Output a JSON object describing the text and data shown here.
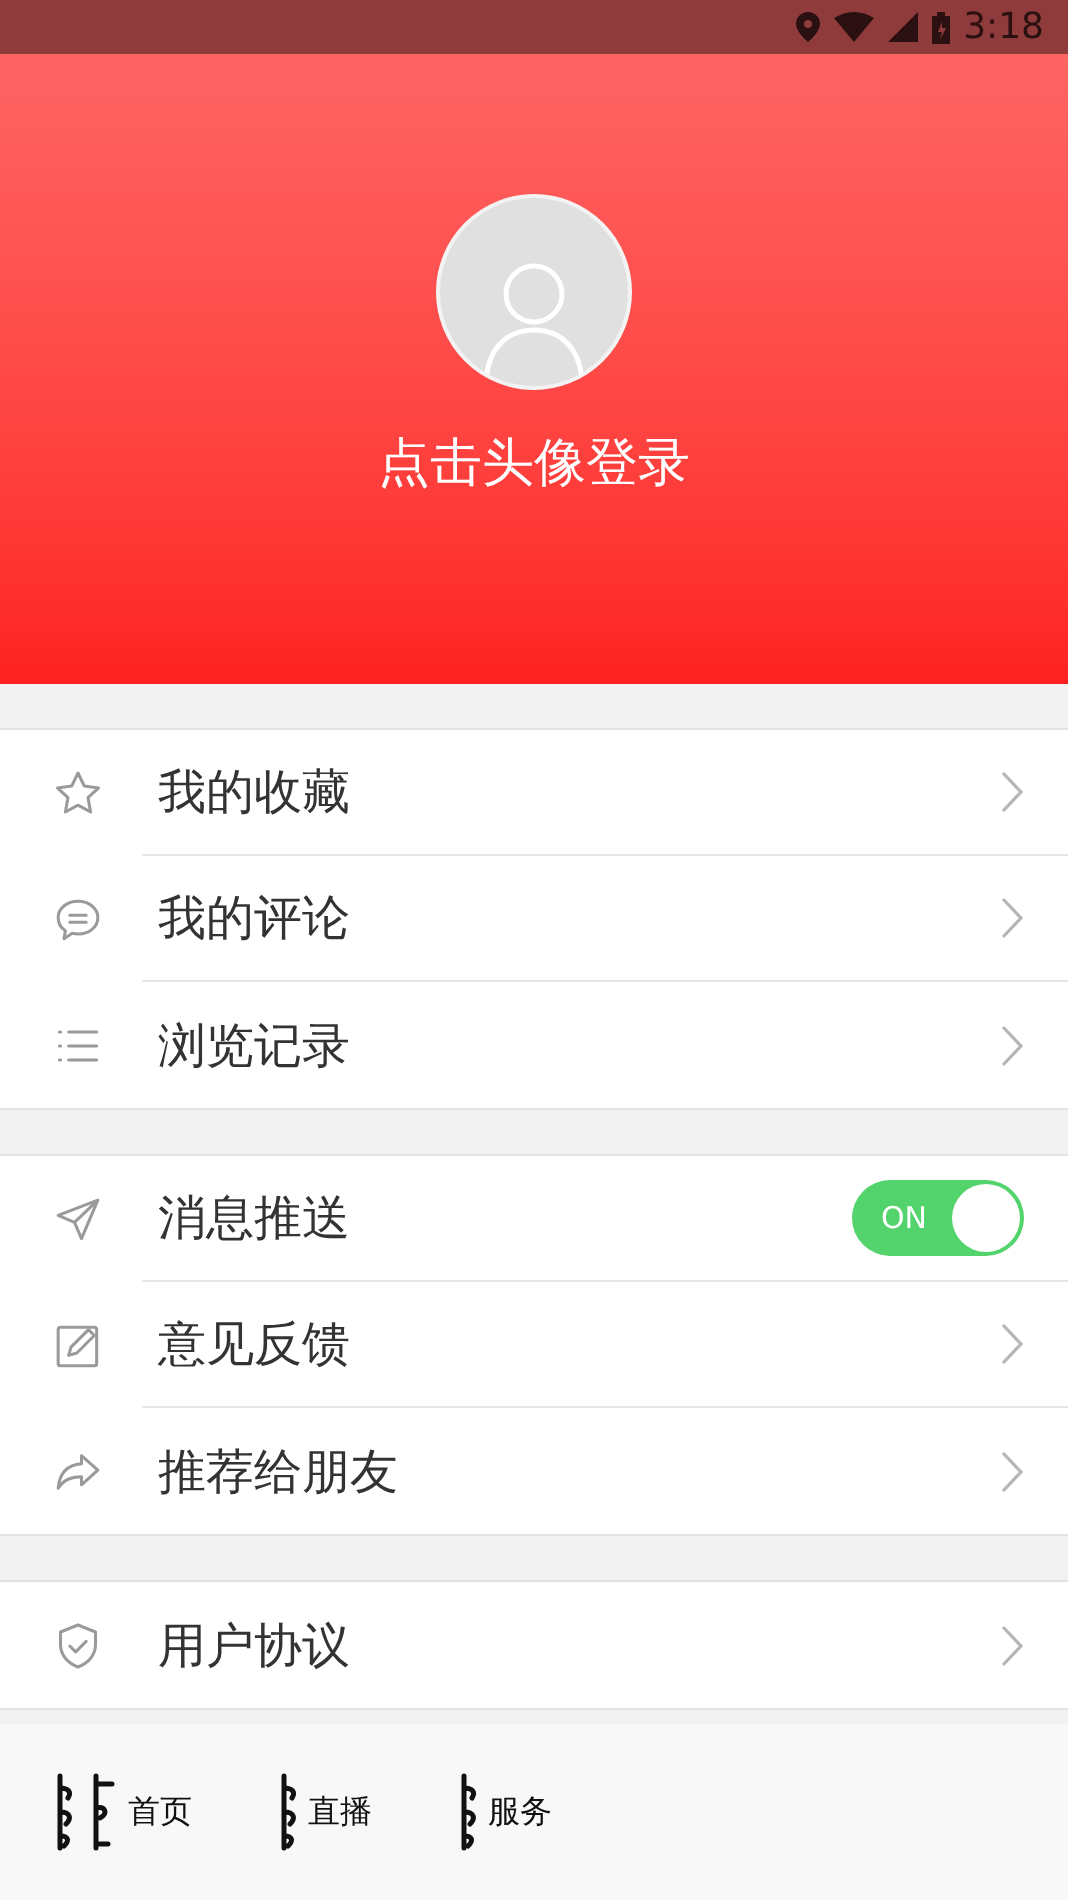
{
  "status_bar": {
    "time": "3:18"
  },
  "profile": {
    "login_prompt": "点击头像登录"
  },
  "sections": [
    {
      "items": [
        {
          "kind": "link",
          "label": "我的收藏"
        },
        {
          "kind": "link",
          "label": "我的评论"
        },
        {
          "kind": "link",
          "label": "浏览记录"
        }
      ]
    },
    {
      "items": [
        {
          "kind": "toggle",
          "label": "消息推送",
          "on": true,
          "toggle_text": "ON"
        },
        {
          "kind": "link",
          "label": "意见反馈"
        },
        {
          "kind": "link",
          "label": "推荐给朋友"
        }
      ]
    },
    {
      "items": [
        {
          "kind": "link",
          "label": "用户协议"
        }
      ]
    }
  ],
  "bottom_nav": [
    {
      "label": "首页"
    },
    {
      "label": "直播"
    },
    {
      "label": "服务"
    }
  ]
}
